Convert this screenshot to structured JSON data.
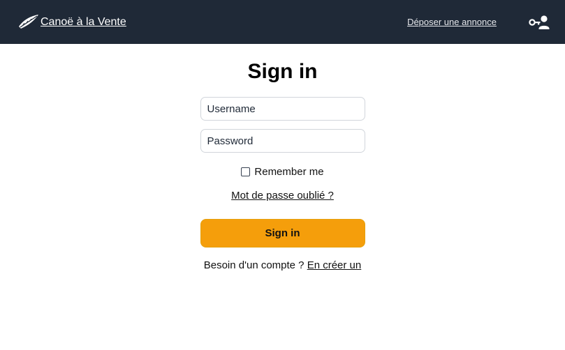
{
  "navbar": {
    "brand_label": "Canoë à la Vente",
    "brand_icon": "canoe-icon",
    "post_ad_label": "Déposer une annonce",
    "user_icon": "person-key-icon",
    "background": "#1f2937"
  },
  "login": {
    "title": "Sign in",
    "username_placeholder": "Username",
    "password_placeholder": "Password",
    "remember_label": "Remember me",
    "remember_checked": false,
    "forgot_label": "Mot de passe oublié ?",
    "submit_label": "Sign in",
    "submit_color": "#f59e0b",
    "signup_prompt": "Besoin d'un compte ?",
    "signup_link": "En créer un"
  }
}
